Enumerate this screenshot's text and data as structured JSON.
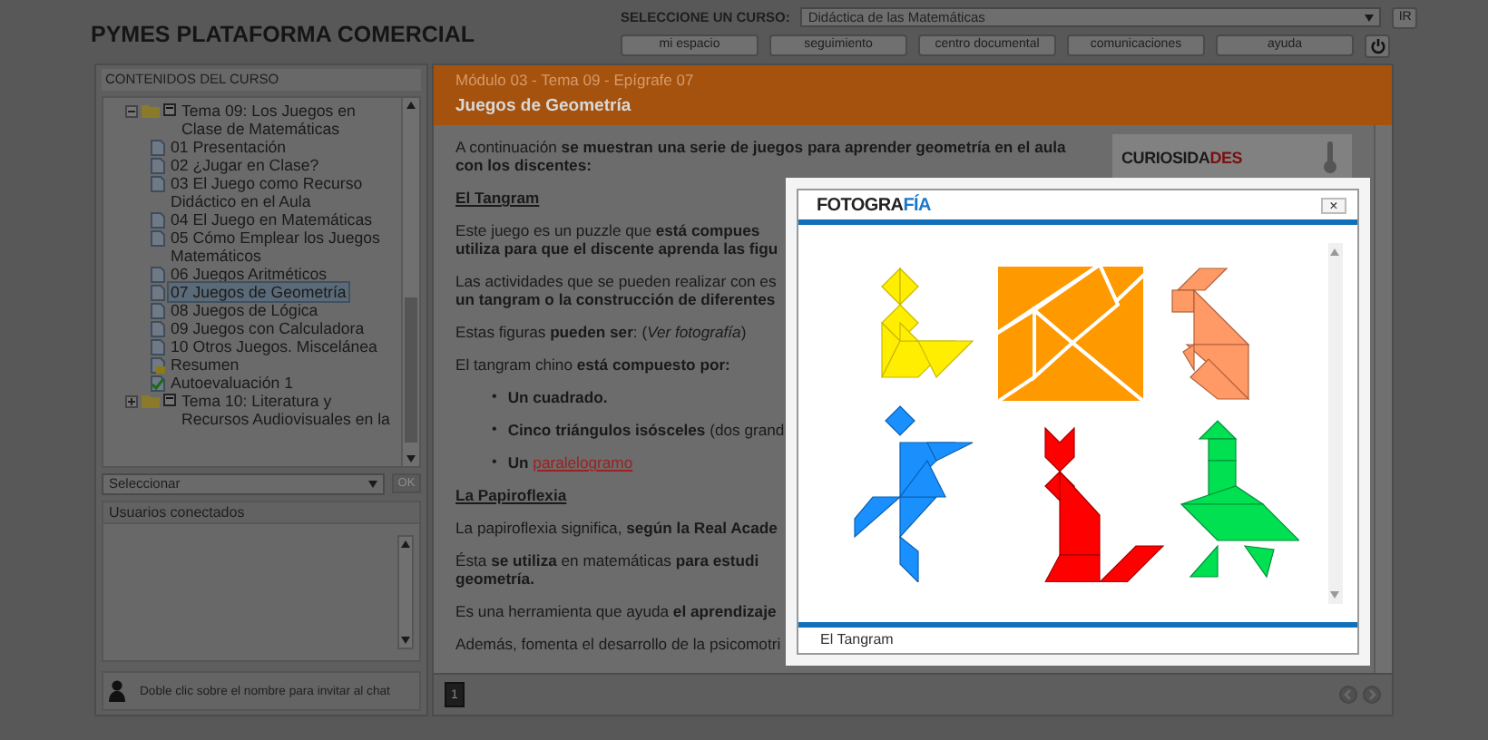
{
  "header": {
    "title": "PYMES PLATAFORMA COMERCIAL",
    "course_label": "SELECCIONE UN CURSO:",
    "course_value": "Didáctica de las Matemáticas",
    "go_button": "IR",
    "nav": [
      "mi espacio",
      "seguimiento",
      "centro documental",
      "comunicaciones",
      "ayuda"
    ]
  },
  "sidebar": {
    "title": "CONTENIDOS DEL CURSO",
    "tree": [
      {
        "label": "Tema 09: Los Juegos en Clase de Matemáticas",
        "kind": "folder",
        "expanded": true,
        "selected": false,
        "children": [
          {
            "label": "01 Presentación",
            "kind": "page",
            "selected": false
          },
          {
            "label": "02 ¿Jugar en Clase?",
            "kind": "page",
            "selected": false
          },
          {
            "label": "03 El Juego como Recurso Didáctico en el Aula",
            "kind": "page",
            "selected": false
          },
          {
            "label": "04 El Juego en Matemáticas",
            "kind": "page",
            "selected": false
          },
          {
            "label": "05 Cómo Emplear los Juegos Matemáticos",
            "kind": "page",
            "selected": false
          },
          {
            "label": "06 Juegos Aritméticos",
            "kind": "page",
            "selected": false
          },
          {
            "label": "07 Juegos de Geometría",
            "kind": "page",
            "selected": true
          },
          {
            "label": "08 Juegos de Lógica",
            "kind": "page",
            "selected": false
          },
          {
            "label": "09 Juegos con Calculadora",
            "kind": "page",
            "selected": false
          },
          {
            "label": "10 Otros Juegos. Miscelánea",
            "kind": "page",
            "selected": false
          },
          {
            "label": "Resumen",
            "kind": "summary",
            "selected": false
          },
          {
            "label": "Autoevaluación 1",
            "kind": "test",
            "selected": false
          }
        ]
      },
      {
        "label": "Tema 10: Literatura y Recursos Audiovisuales en la",
        "kind": "folder",
        "expanded": false,
        "selected": false
      }
    ],
    "select": {
      "value": "Seleccionar",
      "button": "OK",
      "disabled": true
    },
    "users_title": "Usuarios conectados",
    "chat_hint": "Doble clic sobre el nombre para invitar al chat"
  },
  "content": {
    "breadcrumb": "Módulo 03 - Tema 09 - Epígrafe 07",
    "title": "Juegos de Geometría",
    "badge": {
      "text": "CURIOSIDA",
      "accent": "DES"
    },
    "blocks": [
      {
        "kind": "para",
        "lines": [
          "A continuación **se muestran una serie de juegos para aprender geometría en el aula con los discentes:**"
        ]
      },
      {
        "kind": "heading",
        "text": "El Tangram"
      },
      {
        "kind": "para",
        "lines": [
          "Este juego es un puzzle que **está compues**",
          "**utiliza para que el discente aprenda las figu**"
        ]
      },
      {
        "kind": "para",
        "lines": [
          "Las actividades que se pueden realizar con es",
          "**un tangram o la construcción de diferentes**"
        ]
      },
      {
        "kind": "para",
        "lines": [
          "Estas figuras **pueden ser**: (*Ver fotografía*)"
        ]
      },
      {
        "kind": "para",
        "lines": [
          "El tangram chino **está compuesto por:**"
        ]
      },
      {
        "kind": "bullets",
        "bullet": "•",
        "items": [
          {
            "text": "**Un cuadrado.**"
          },
          {
            "text": "**Cinco triángulos isósceles** (dos grand"
          },
          {
            "text": "**Un**",
            "link": "paralelogramo"
          }
        ]
      },
      {
        "kind": "heading",
        "text": "La Papiroflexia"
      },
      {
        "kind": "para",
        "lines": [
          "La papiroflexia significa, **según la Real Acade**"
        ]
      },
      {
        "kind": "para",
        "lines": [
          "Ésta **se utiliza** en matemáticas **para estudi**",
          "**geometría.**"
        ]
      },
      {
        "kind": "para",
        "lines": [
          "Es una herramienta que ayuda **el aprendizaje**"
        ]
      },
      {
        "kind": "para",
        "lines": [
          "Además, fomenta el desarrollo de la psicomotri"
        ]
      }
    ],
    "page": "1"
  },
  "modal": {
    "logo": "FOTOGRA",
    "logo_accent": "FÍA",
    "close": "×",
    "caption": "El Tangram"
  }
}
